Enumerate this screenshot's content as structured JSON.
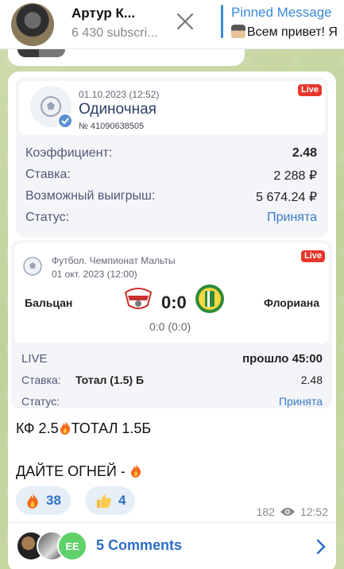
{
  "header": {
    "channel_name": "Артур К...",
    "subscribers": "6 430 subscri...",
    "pinned_title": "Pinned Message",
    "pinned_text": "Всем привет! Я"
  },
  "bet": {
    "date": "01.10.2023 (12:52)",
    "type": "Одиночная",
    "number": "№ 41090638505",
    "live_badge": "Live",
    "rows": [
      {
        "label": "Коэффициент:",
        "value": "2.48"
      },
      {
        "label": "Ставка:",
        "value": "2 288 ₽"
      },
      {
        "label": "Возможный выигрыш:",
        "value": "5 674.24 ₽"
      },
      {
        "label": "Статус:",
        "value": "Принята"
      }
    ]
  },
  "event": {
    "league": "Футбол. Чемпионат Мальты",
    "date": "01 окт. 2023 (12:00)",
    "live_badge": "Live",
    "home_team": "Бальцан",
    "away_team": "Флориана",
    "score": "0:0",
    "score_detail": "0:0 (0:0)",
    "live_label": "LIVE",
    "elapsed": "прошло 45:00",
    "stake_label": "Ставка:",
    "stake_market": "Тотал (1.5) Б",
    "stake_odds": "2.48",
    "status_label": "Статус:",
    "status_value": "Принята"
  },
  "message": {
    "line1_a": "КФ 2.5",
    "line1_b": "ТОТАЛ 1.5Б",
    "line2": "ДАЙТЕ ОГНЕЙ - "
  },
  "reactions": [
    {
      "icon": "fire-icon",
      "count": "38"
    },
    {
      "icon": "thumbs-up-icon",
      "count": "4"
    }
  ],
  "meta": {
    "views": "182",
    "time": "12:52"
  },
  "comments": {
    "label": "5 Comments",
    "avatar_initials": "EE"
  },
  "colors": {
    "accent": "#2d6fc4",
    "live": "#e8362b",
    "pinned": "#3a8ad8"
  }
}
